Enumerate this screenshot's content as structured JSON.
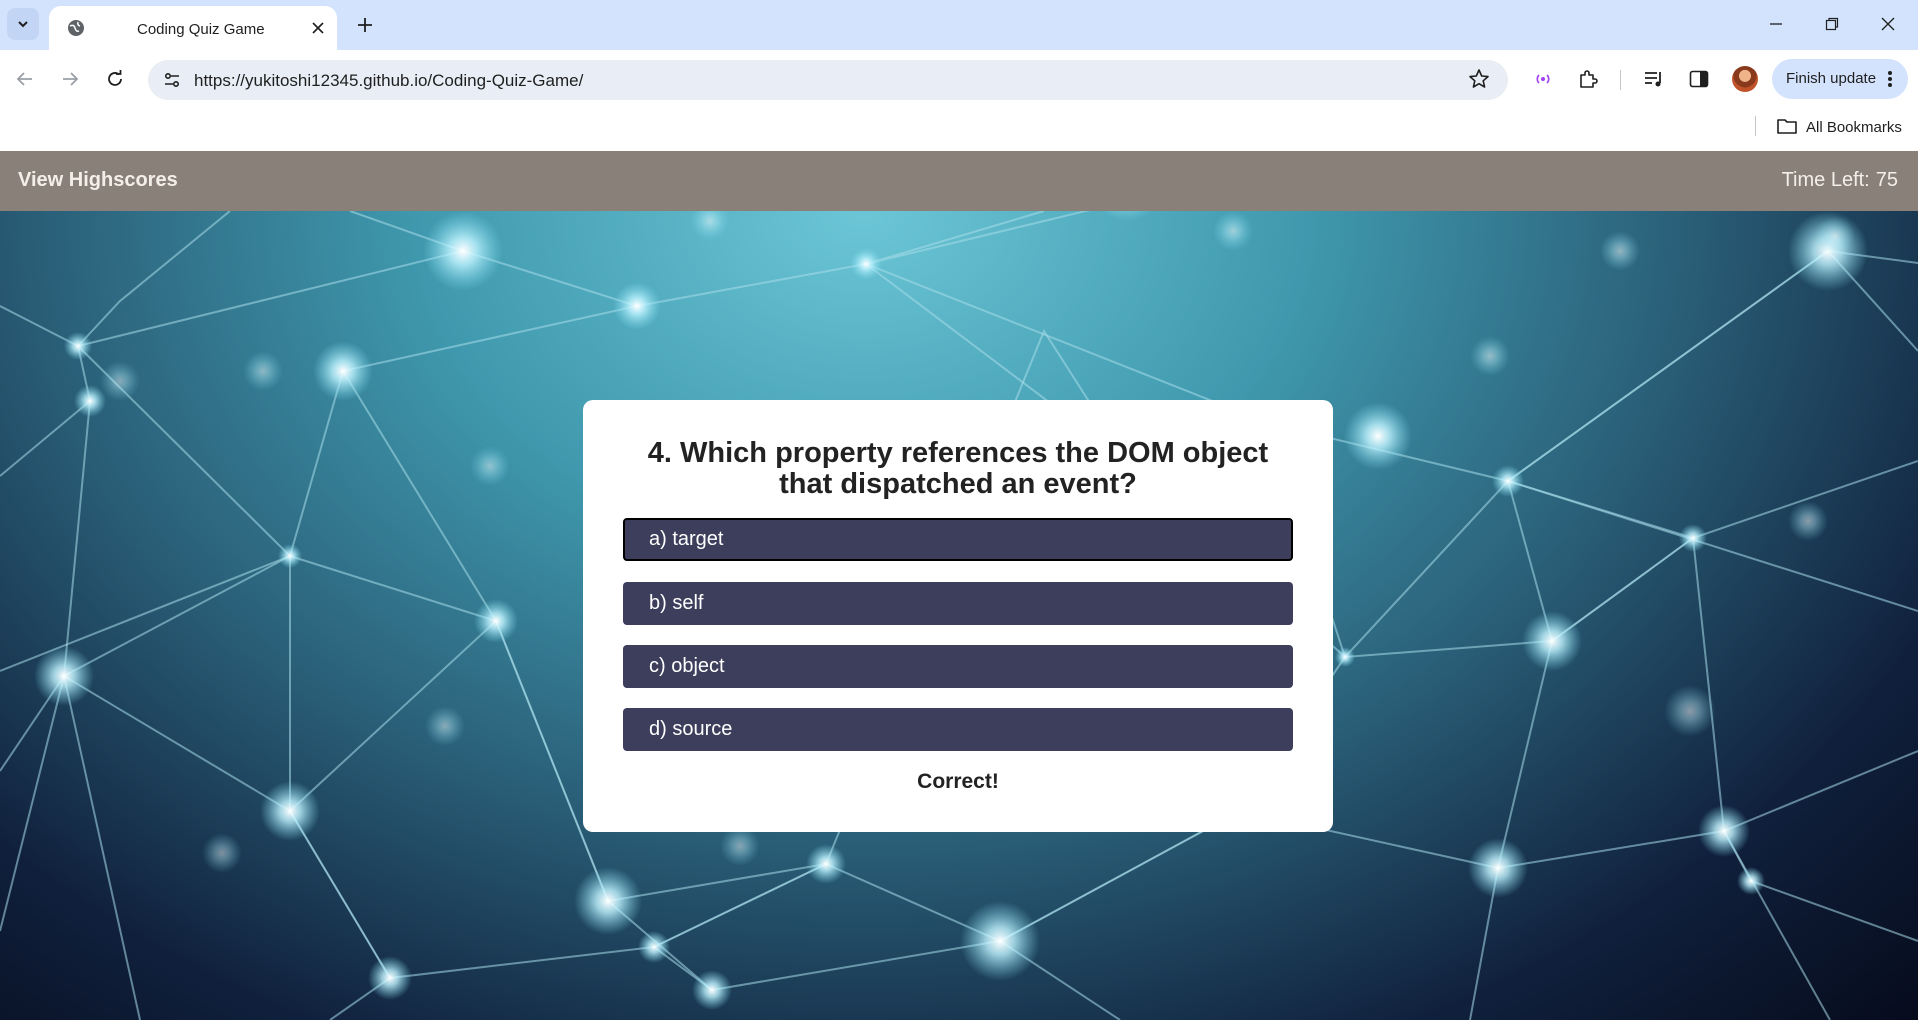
{
  "browser": {
    "tab": {
      "title": "Coding Quiz Game"
    },
    "url": "https://yukitoshi12345.github.io/Coding-Quiz-Game/",
    "update_button": "Finish update",
    "bookmarks": {
      "all_bookmarks": "All Bookmarks"
    },
    "colors": {
      "tabstrip": "#d3e3fd",
      "omnibox": "#e9eef6"
    }
  },
  "header": {
    "highscores_link": "View Highscores",
    "timer_label": "Time Left:",
    "timer_value": "75",
    "background": "#8a807a"
  },
  "quiz": {
    "question": "4. Which property references the DOM object that dispatched an event?",
    "choices": [
      {
        "label": "a) target"
      },
      {
        "label": "b) self"
      },
      {
        "label": "c) object"
      },
      {
        "label": "d) source"
      }
    ],
    "feedback": "Correct!",
    "choice_color": "#3d3e5b"
  },
  "icons": [
    "tab-search-icon",
    "globe-icon",
    "close-icon",
    "plus-icon",
    "minimize-icon",
    "restore-icon",
    "back-icon",
    "forward-icon",
    "reload-icon",
    "site-info-icon",
    "star-icon",
    "cast-icon",
    "extensions-icon",
    "media-icon",
    "side-panel-icon",
    "more-icon",
    "folder-icon"
  ]
}
